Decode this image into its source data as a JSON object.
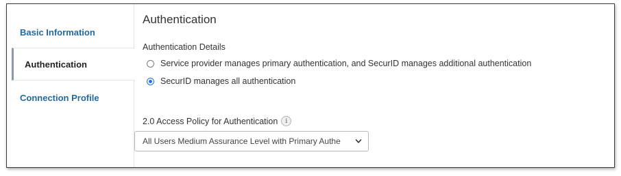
{
  "sidebar": {
    "items": [
      {
        "label": "Basic Information"
      },
      {
        "label": "Authentication"
      },
      {
        "label": "Connection Profile"
      }
    ]
  },
  "main": {
    "title": "Authentication",
    "details_label": "Authentication Details",
    "options": [
      {
        "label": "Service provider manages primary authentication, and SecurID manages additional authentication",
        "selected": false
      },
      {
        "label": "SecurID manages all authentication",
        "selected": true
      }
    ],
    "policy_label": "2.0 Access Policy for Authentication",
    "info_glyph": "i",
    "policy_value": "All Users Medium Assurance Level with Primary Authe"
  },
  "colors": {
    "link": "#1f6aa5",
    "radio_selected": "#1a73e8"
  },
  "icons": [
    "info-icon",
    "chevron-down-icon"
  ]
}
